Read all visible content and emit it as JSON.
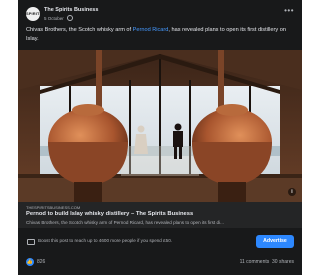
{
  "post": {
    "page_name": "The Spirits Business",
    "avatar_text": "SPIRITS",
    "date": "5 October",
    "visibility_icon": "globe-icon",
    "text_before_link": "Chivas Brothers, the Scotch whisky arm of ",
    "text_link": "Pernod Ricard",
    "text_after_link": ", has revealed plans to open its first distillery on Islay.",
    "more_label": "•••"
  },
  "link_preview": {
    "domain": "THESPIRITSBUSINESS.COM",
    "title": "Pernod to build Islay whisky distillery – The Spirits Business",
    "description": "Chivas Brothers, the Scotch whisky arm of Pernod Ricard, has revealed plans to open its first di...",
    "info_label": "i"
  },
  "boost": {
    "text": "Boost this post to reach up to 4600 more people if you spend £50.",
    "button_label": "Advertise"
  },
  "stats": {
    "likes": "826",
    "comments": "11 comments",
    "shares": "30 shares"
  },
  "colors": {
    "card_bg": "#18191a",
    "link_color": "#4599ff",
    "button_blue": "#2d88ff",
    "copper": "#b0623a"
  }
}
